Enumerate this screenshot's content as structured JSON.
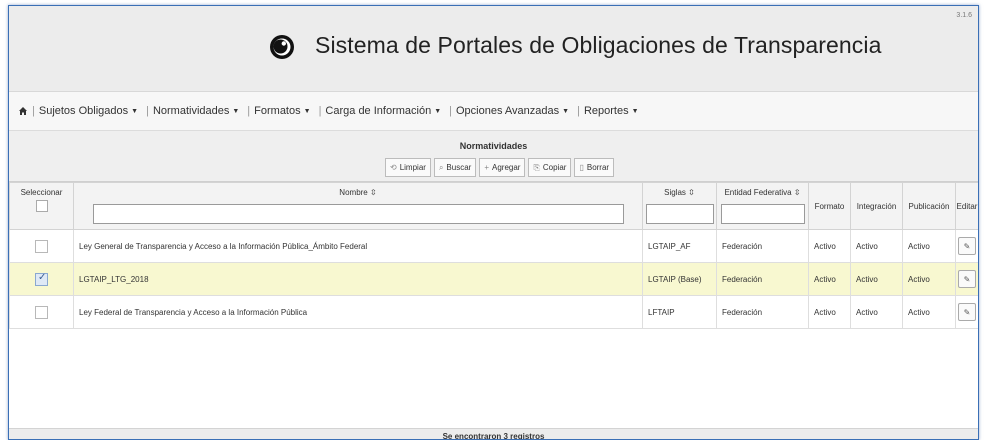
{
  "header": {
    "title": "Sistema de Portales de Obligaciones de Transparencia",
    "version": "3.1.6"
  },
  "nav": {
    "items": [
      {
        "label": "Sujetos Obligados",
        "caret": true
      },
      {
        "label": "Normatividades",
        "caret": true
      },
      {
        "label": "Formatos",
        "caret": true
      },
      {
        "label": "Carga de Información",
        "caret": true
      },
      {
        "label": "Opciones Avanzadas",
        "caret": true
      },
      {
        "label": "Reportes",
        "caret": true
      }
    ]
  },
  "panel": {
    "title": "Normatividades",
    "toolbar": {
      "clear": "Limpiar",
      "search": "Buscar",
      "add": "Agregar",
      "copy": "Copiar",
      "delete": "Borrar"
    }
  },
  "table": {
    "headers": {
      "select": "Seleccionar",
      "name": "Nombre",
      "acronym": "Siglas",
      "entity": "Entidad Federativa",
      "format": "Formato",
      "integration": "Integración",
      "publication": "Publicación",
      "edit": "Editar"
    },
    "rows": [
      {
        "checked": false,
        "name": "Ley General de Transparencia y Acceso a la Información Pública_Ámbito Federal",
        "acronym": "LGTAIP_AF",
        "entity": "Federación",
        "format": "Activo",
        "integration": "Activo",
        "publication": "Activo"
      },
      {
        "checked": true,
        "name": "LGTAIP_LTG_2018",
        "acronym": "LGTAIP (Base)",
        "entity": "Federación",
        "format": "Activo",
        "integration": "Activo",
        "publication": "Activo"
      },
      {
        "checked": false,
        "name": "Ley Federal de Transparencia y Acceso a la Información Pública",
        "acronym": "LFTAIP",
        "entity": "Federación",
        "format": "Activo",
        "integration": "Activo",
        "publication": "Activo"
      }
    ]
  },
  "footer": {
    "records": "Se encontraron 3 registros"
  }
}
